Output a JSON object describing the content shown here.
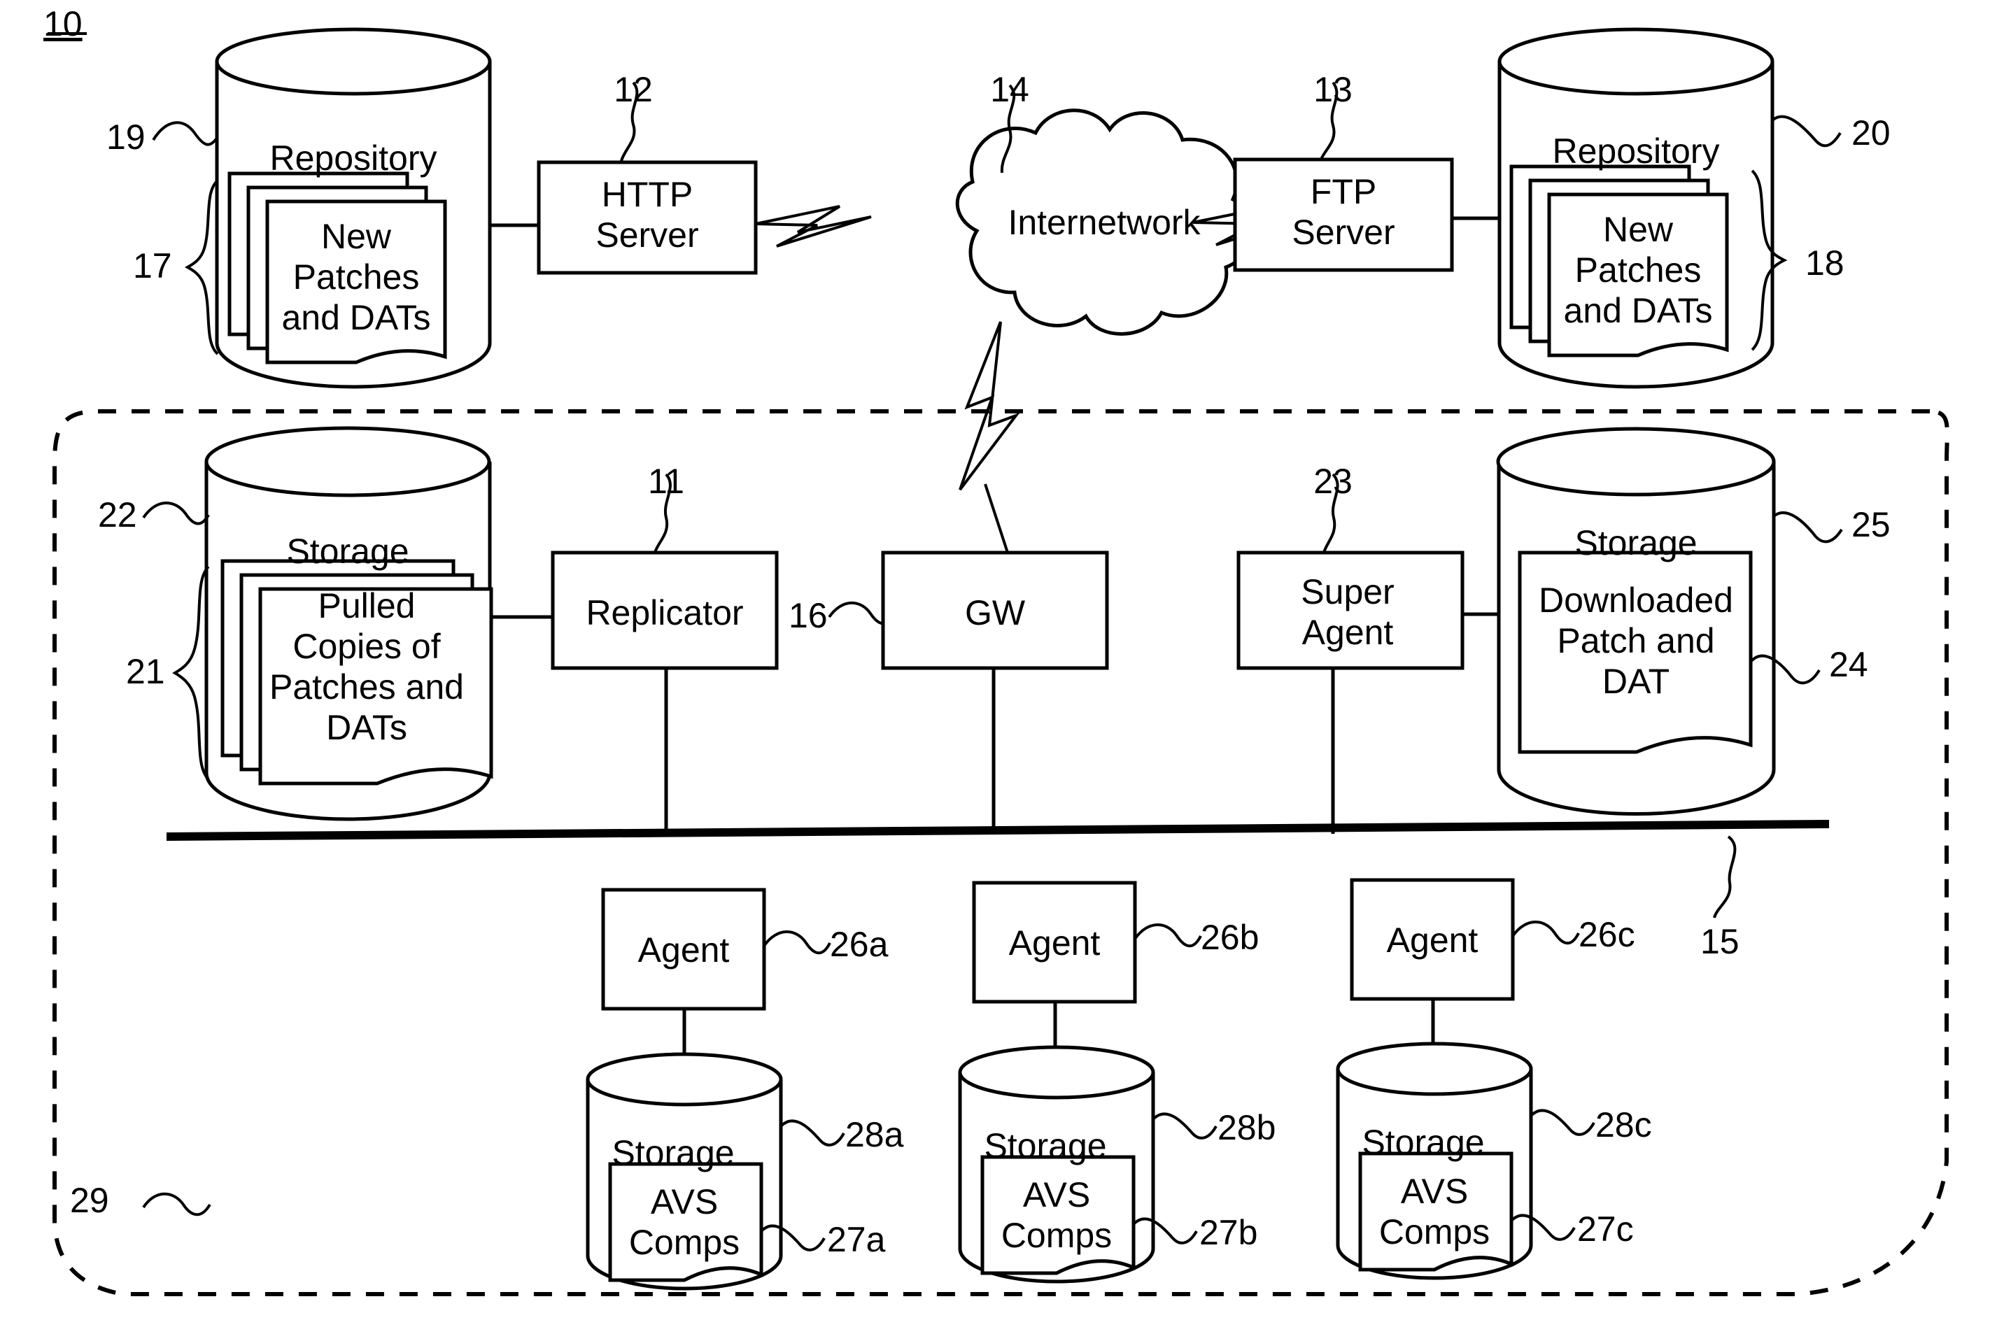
{
  "figure": {
    "number": "10"
  },
  "nodes": {
    "repo_left": {
      "title": "Repository",
      "doc_lines": [
        "New",
        "Patches",
        "and DATs"
      ],
      "ref_cyl": "19",
      "ref_docs": "17"
    },
    "http_server": {
      "lines": [
        "HTTP",
        "Server"
      ],
      "ref": "12"
    },
    "internetwork": {
      "label": "Internetwork",
      "ref": "14"
    },
    "ftp_server": {
      "lines": [
        "FTP",
        "Server"
      ],
      "ref": "13"
    },
    "repo_right": {
      "title": "Repository",
      "doc_lines": [
        "New",
        "Patches",
        "and DATs"
      ],
      "ref_cyl": "20",
      "ref_docs": "18"
    },
    "storage_left": {
      "title": "Storage",
      "doc_lines": [
        "Pulled",
        "Copies of",
        "Patches and",
        "DATs"
      ],
      "ref_cyl": "22",
      "ref_docs": "21"
    },
    "replicator": {
      "label": "Replicator",
      "ref": "11"
    },
    "gateway": {
      "label": "GW",
      "ref": "16"
    },
    "super_agent": {
      "lines": [
        "Super",
        "Agent"
      ],
      "ref": "23"
    },
    "storage_right": {
      "title": "Storage",
      "doc_lines": [
        "Downloaded",
        "Patch and",
        "DAT"
      ],
      "ref_cyl": "25",
      "ref_docs": "24"
    },
    "bus": {
      "ref": "15"
    },
    "enclosure": {
      "ref": "29"
    },
    "agents": [
      {
        "label": "Agent",
        "ref": "26a"
      },
      {
        "label": "Agent",
        "ref": "26b"
      },
      {
        "label": "Agent",
        "ref": "26c"
      }
    ],
    "agent_storages": [
      {
        "title": "Storage",
        "doc_lines": [
          "AVS",
          "Comps"
        ],
        "ref_cyl": "28a",
        "ref_docs": "27a"
      },
      {
        "title": "Storage",
        "doc_lines": [
          "AVS",
          "Comps"
        ],
        "ref_cyl": "28b",
        "ref_docs": "27b"
      },
      {
        "title": "Storage",
        "doc_lines": [
          "AVS",
          "Comps"
        ],
        "ref_cyl": "28c",
        "ref_docs": "27c"
      }
    ]
  },
  "colors": {
    "stroke": "#000000",
    "background": "#ffffff"
  }
}
